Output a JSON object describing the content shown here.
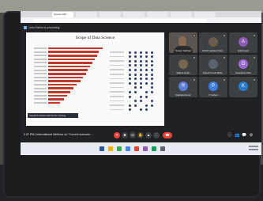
{
  "colors": {
    "screen_bg": "#202124",
    "slide_bg": "#fafafa",
    "bar_color": "#c0392b",
    "dot_color": "#2c3e6b",
    "leave_red": "#ea4335",
    "presenting_accent": "#8ab4f8"
  },
  "browser": {
    "tabs": [
      {
        "label": "Naveen MB ... ",
        "active": true
      },
      {
        "label": "",
        "active": false
      },
      {
        "label": "",
        "active": false
      },
      {
        "label": "",
        "active": false
      },
      {
        "label": "",
        "active": false
      },
      {
        "label": "",
        "active": false
      },
      {
        "label": "",
        "active": false
      }
    ]
  },
  "presenting_banner": "John Rahim is presenting",
  "slide": {
    "title": "Scope of Data Science",
    "caption": "research almost last till the coming",
    "bars": [
      0.98,
      0.92,
      0.88,
      0.84,
      0.8,
      0.76,
      0.72,
      0.68,
      0.63,
      0.58,
      0.52,
      0.46,
      0.4,
      0.34,
      0.28,
      0.22
    ]
  },
  "participants": [
    {
      "name": "Naveen Kallingal",
      "type": "video",
      "avatar_letter": ""
    },
    {
      "name": "Prof.Dr.Sasheesh Pan...",
      "type": "photo",
      "avatar_letter": "",
      "avatar_color": "#6b5b4a"
    },
    {
      "name": "Anila Kumar",
      "type": "avatar",
      "avatar_letter": "A",
      "avatar_color": "#8e5bb5"
    },
    {
      "name": "Rakesh Addan",
      "type": "photo",
      "avatar_letter": "",
      "avatar_color": "#7a6650"
    },
    {
      "name": "Sukesh Kumar Mitha...",
      "type": "photo",
      "avatar_letter": "",
      "avatar_color": "#5a6470"
    },
    {
      "name": "Ganeshram Ravi",
      "type": "avatar",
      "avatar_letter": "G",
      "avatar_color": "#9c6bd1"
    },
    {
      "name": "Rajendra Kumar",
      "type": "avatar",
      "avatar_letter": "R",
      "avatar_color": "#5c7bd6"
    },
    {
      "name": "P. Suthan",
      "type": "avatar",
      "avatar_letter": "P",
      "avatar_color": "#3d7fe0"
    },
    {
      "name": "",
      "type": "avatar",
      "avatar_letter": "K",
      "avatar_color": "#2a7ccf"
    }
  ],
  "controls": {
    "meeting_info": "3:37 PM  |  International Webinar on \"Current scenario ...",
    "buttons": [
      {
        "icon": "mic-off-icon",
        "glyph": "✕",
        "red": true
      },
      {
        "icon": "camera-icon",
        "glyph": "■",
        "red": false
      },
      {
        "icon": "captions-icon",
        "glyph": "cc",
        "red": false
      },
      {
        "icon": "hand-icon",
        "glyph": "✋",
        "red": false
      },
      {
        "icon": "present-icon",
        "glyph": "▲",
        "red": false
      },
      {
        "icon": "more-icon",
        "glyph": "⋮",
        "red": false
      }
    ],
    "leave_glyph": "☎",
    "right_icons": [
      {
        "icon": "info-icon",
        "glyph": "ⓘ"
      },
      {
        "icon": "people-icon",
        "glyph": "👥"
      },
      {
        "icon": "chat-icon",
        "glyph": "💬"
      },
      {
        "icon": "activities-icon",
        "glyph": "⚙"
      }
    ]
  }
}
